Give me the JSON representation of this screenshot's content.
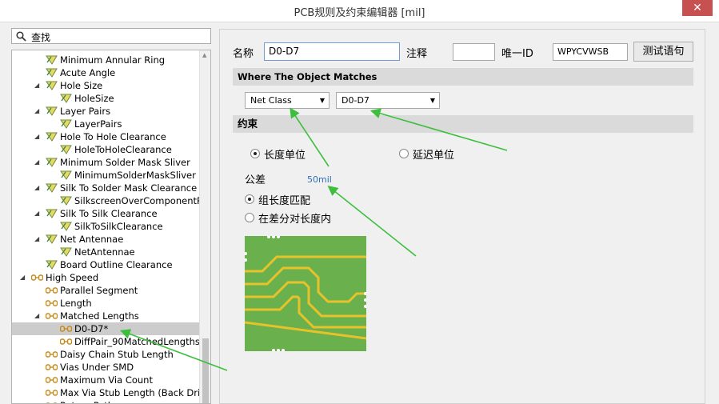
{
  "window": {
    "title": "PCB规则及约束编辑器 [mil]",
    "close_glyph": "✕"
  },
  "search": {
    "label": "查找"
  },
  "tree": {
    "items": [
      {
        "label": "Minimum Annular Ring",
        "indent": 1,
        "icon": "rule-icon"
      },
      {
        "label": "Acute Angle",
        "indent": 1,
        "icon": "rule-icon"
      },
      {
        "label": "Hole Size",
        "indent": 1,
        "icon": "rule-icon",
        "expanded": true
      },
      {
        "label": "HoleSize",
        "indent": 2,
        "icon": "rule-icon"
      },
      {
        "label": "Layer Pairs",
        "indent": 1,
        "icon": "rule-icon",
        "expanded": true
      },
      {
        "label": "LayerPairs",
        "indent": 2,
        "icon": "rule-icon"
      },
      {
        "label": "Hole To Hole Clearance",
        "indent": 1,
        "icon": "rule-icon",
        "expanded": true
      },
      {
        "label": "HoleToHoleClearance",
        "indent": 2,
        "icon": "rule-icon"
      },
      {
        "label": "Minimum Solder Mask Sliver",
        "indent": 1,
        "icon": "rule-icon",
        "expanded": true
      },
      {
        "label": "MinimumSolderMaskSliver",
        "indent": 2,
        "icon": "rule-icon"
      },
      {
        "label": "Silk To Solder Mask Clearance",
        "indent": 1,
        "icon": "rule-icon",
        "expanded": true
      },
      {
        "label": "SilkscreenOverComponentPads",
        "indent": 2,
        "icon": "rule-icon"
      },
      {
        "label": "Silk To Silk Clearance",
        "indent": 1,
        "icon": "rule-icon",
        "expanded": true
      },
      {
        "label": "SilkToSilkClearance",
        "indent": 2,
        "icon": "rule-icon"
      },
      {
        "label": "Net Antennae",
        "indent": 1,
        "icon": "rule-icon",
        "expanded": true
      },
      {
        "label": "NetAntennae",
        "indent": 2,
        "icon": "rule-icon"
      },
      {
        "label": "Board Outline Clearance",
        "indent": 1,
        "icon": "rule-icon"
      },
      {
        "label": "High Speed",
        "indent": 0,
        "icon": "highspeed-icon",
        "expanded": true
      },
      {
        "label": "Parallel Segment",
        "indent": 1,
        "icon": "highspeed-icon"
      },
      {
        "label": "Length",
        "indent": 1,
        "icon": "highspeed-icon"
      },
      {
        "label": "Matched Lengths",
        "indent": 1,
        "icon": "highspeed-icon",
        "expanded": true
      },
      {
        "label": "D0-D7*",
        "indent": 2,
        "icon": "highspeed-icon",
        "selected": true
      },
      {
        "label": "DiffPair_90MatchedLengths",
        "indent": 2,
        "icon": "highspeed-icon"
      },
      {
        "label": "Daisy Chain Stub Length",
        "indent": 1,
        "icon": "highspeed-icon"
      },
      {
        "label": "Vias Under SMD",
        "indent": 1,
        "icon": "highspeed-icon"
      },
      {
        "label": "Maximum Via Count",
        "indent": 1,
        "icon": "highspeed-icon"
      },
      {
        "label": "Max Via Stub Length (Back Drilling)",
        "indent": 1,
        "icon": "highspeed-icon"
      },
      {
        "label": "Return Path",
        "indent": 1,
        "icon": "highspeed-icon"
      }
    ]
  },
  "form": {
    "name_label": "名称",
    "name_value": "D0-D7",
    "comment_label": "注释",
    "comment_value": "",
    "uid_label": "唯一ID",
    "uid_value": "WPYCVWSB",
    "test_button": "测试语句"
  },
  "where": {
    "header": "Where The Object Matches",
    "scope_type": "Net Class",
    "scope_value": "D0-D7"
  },
  "constraints": {
    "header": "约束",
    "length_unit": "长度单位",
    "delay_unit": "延迟单位",
    "tolerance_label": "公差",
    "tolerance_value": "50mil",
    "group_match": "组长度匹配",
    "within_pair": "在差分对长度内"
  },
  "colors": {
    "arrow": "#3dbf3d",
    "pcb_board": "#6ab04c",
    "pcb_trace": "#e8c22a",
    "selection": "#cccccc"
  }
}
